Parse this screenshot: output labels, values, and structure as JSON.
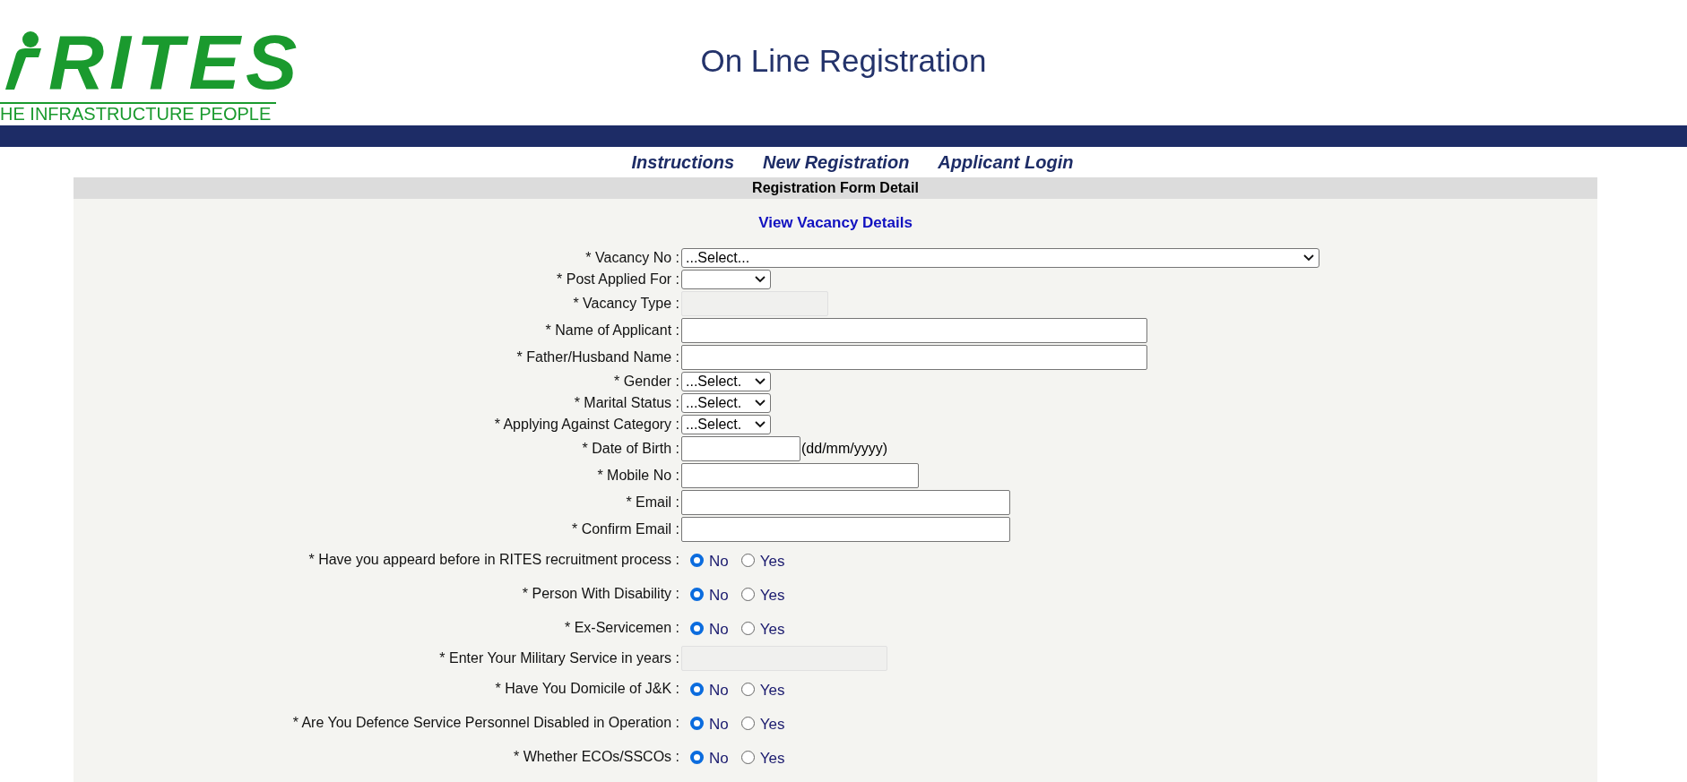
{
  "header": {
    "logo_text": "RITES",
    "tagline": "HE INFRASTRUCTURE PEOPLE",
    "title": "On Line Registration"
  },
  "nav": [
    {
      "label": "Instructions"
    },
    {
      "label": "New Registration"
    },
    {
      "label": "Applicant Login"
    }
  ],
  "form": {
    "heading": "Registration Form Detail",
    "link": "View Vacancy Details",
    "fields": [
      {
        "kind": "select",
        "label": "* Vacancy No :",
        "value": "...Select..."
      },
      {
        "kind": "select",
        "label": "* Post Applied For :"
      },
      {
        "kind": "disabled-input",
        "label": "* Vacancy Type :"
      },
      {
        "kind": "input",
        "label": "* Name of Applicant :"
      },
      {
        "kind": "input",
        "label": "* Father/Husband Name :"
      },
      {
        "kind": "select",
        "label": "* Gender :",
        "value": "...Select."
      },
      {
        "kind": "select",
        "label": "* Marital Status :",
        "value": "...Select."
      },
      {
        "kind": "select",
        "label": "* Applying Against Category :",
        "value": "...Select."
      },
      {
        "kind": "input",
        "label": "* Date of Birth :",
        "hint": "(dd/mm/yyyy)"
      },
      {
        "kind": "input",
        "label": "* Mobile No :"
      },
      {
        "kind": "input",
        "label": "* Email :"
      },
      {
        "kind": "input",
        "label": "* Confirm Email :"
      },
      {
        "kind": "radio",
        "label": "* Have you appeard before in RITES recruitment process :",
        "options": [
          {
            "label": "No",
            "selected": true
          },
          {
            "label": "Yes",
            "selected": false
          }
        ]
      },
      {
        "kind": "radio",
        "label": "* Person With Disability :",
        "options": [
          {
            "label": "No",
            "selected": true
          },
          {
            "label": "Yes",
            "selected": false
          }
        ]
      },
      {
        "kind": "radio",
        "label": "* Ex-Servicemen :",
        "options": [
          {
            "label": "No",
            "selected": true
          },
          {
            "label": "Yes",
            "selected": false
          }
        ]
      },
      {
        "kind": "disabled-input",
        "label": "* Enter Your Military Service in years :"
      },
      {
        "kind": "radio",
        "label": "* Have You Domicile of J&K :",
        "options": [
          {
            "label": "No",
            "selected": true
          },
          {
            "label": "Yes",
            "selected": false
          }
        ]
      },
      {
        "kind": "radio",
        "label": "* Are You Defence Service Personnel Disabled in Operation :",
        "options": [
          {
            "label": "No",
            "selected": true
          },
          {
            "label": "Yes",
            "selected": false
          }
        ]
      },
      {
        "kind": "radio",
        "label": "* Whether ECOs/SSCOs :",
        "options": [
          {
            "label": "No",
            "selected": true
          },
          {
            "label": "Yes",
            "selected": false
          }
        ]
      }
    ]
  }
}
